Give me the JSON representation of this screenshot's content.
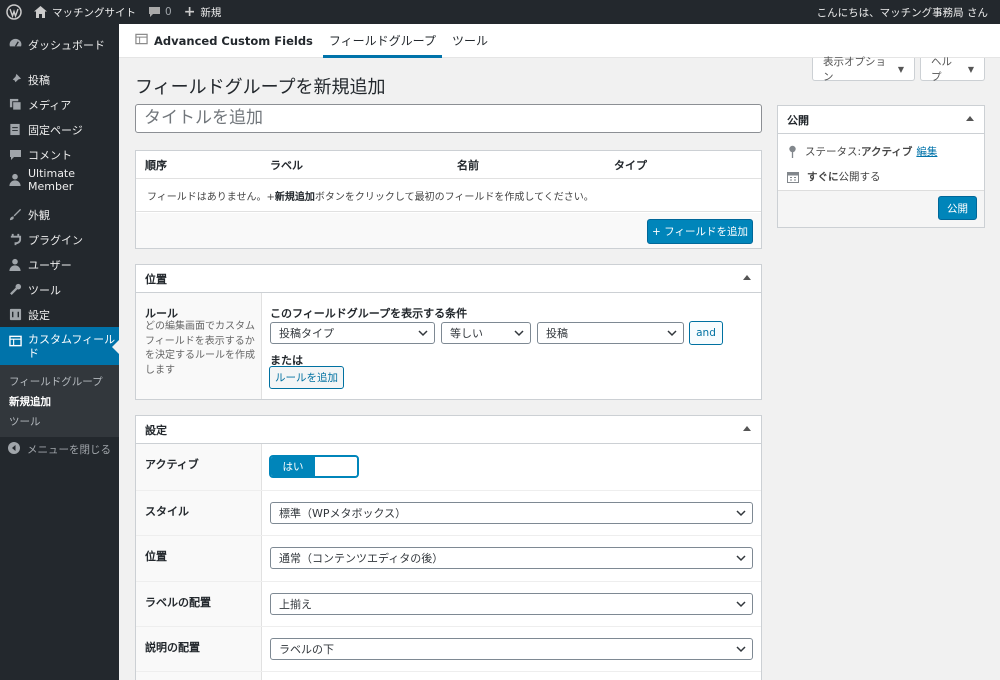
{
  "admin_bar": {
    "site_name": "マッチングサイト",
    "comments_count": "0",
    "new_label": "新規",
    "greeting": "こんにちは、マッチング事務局 さん"
  },
  "sidebar": {
    "items": [
      {
        "label": "ダッシュボード",
        "icon": "dashboard-icon"
      },
      {
        "label": "投稿",
        "icon": "pin-icon"
      },
      {
        "label": "メディア",
        "icon": "media-icon"
      },
      {
        "label": "固定ページ",
        "icon": "page-icon"
      },
      {
        "label": "コメント",
        "icon": "comment-icon"
      },
      {
        "label": "Ultimate Member",
        "icon": "user-icon"
      },
      {
        "label": "外観",
        "icon": "brush-icon"
      },
      {
        "label": "プラグイン",
        "icon": "plugin-icon"
      },
      {
        "label": "ユーザー",
        "icon": "users-icon"
      },
      {
        "label": "ツール",
        "icon": "wrench-icon"
      },
      {
        "label": "設定",
        "icon": "settings-icon"
      },
      {
        "label": "カスタムフィールド",
        "icon": "table-icon"
      }
    ],
    "submenu": [
      "フィールドグループ",
      "新規追加",
      "ツール"
    ],
    "collapse_label": "メニューを閉じる"
  },
  "acf_bar": {
    "brand": "Advanced Custom Fields",
    "tabs": [
      "フィールドグループ",
      "ツール"
    ]
  },
  "screen_options": {
    "display": "表示オプション",
    "help": "ヘルプ"
  },
  "page_title": "フィールドグループを新規追加",
  "title_placeholder": "タイトルを追加",
  "fields_table": {
    "headers": [
      "順序",
      "ラベル",
      "名前",
      "タイプ"
    ],
    "empty_pre": "フィールドはありません。+ ",
    "empty_bold": "新規追加",
    "empty_post": "ボタンをクリックして最初のフィールドを作成してください。",
    "add_button": "+ フィールドを追加"
  },
  "location": {
    "title": "位置",
    "rules_label": "ルール",
    "rules_desc": "どの編集画面でカスタムフィールドを表示するかを決定するルールを作成します",
    "condition_title": "このフィールドグループを表示する条件",
    "param": "投稿タイプ",
    "operator": "等しい",
    "value": "投稿",
    "and_label": "and",
    "or_label": "または",
    "add_rule": "ルールを追加"
  },
  "settings": {
    "title": "設定",
    "active_label": "アクティブ",
    "active_value": "はい",
    "rows": [
      {
        "label": "スタイル",
        "value": "標準（WPメタボックス）"
      },
      {
        "label": "位置",
        "value": "通常（コンテンツエディタの後）"
      },
      {
        "label": "ラベルの配置",
        "value": "上揃え"
      },
      {
        "label": "説明の配置",
        "value": "ラベルの下"
      }
    ]
  },
  "publish": {
    "title": "公開",
    "status_label": "ステータス: ",
    "status_value": "アクティブ",
    "edit_link": "編集",
    "schedule_bold": "すぐに",
    "schedule_text": "公開する",
    "button": "公開"
  }
}
